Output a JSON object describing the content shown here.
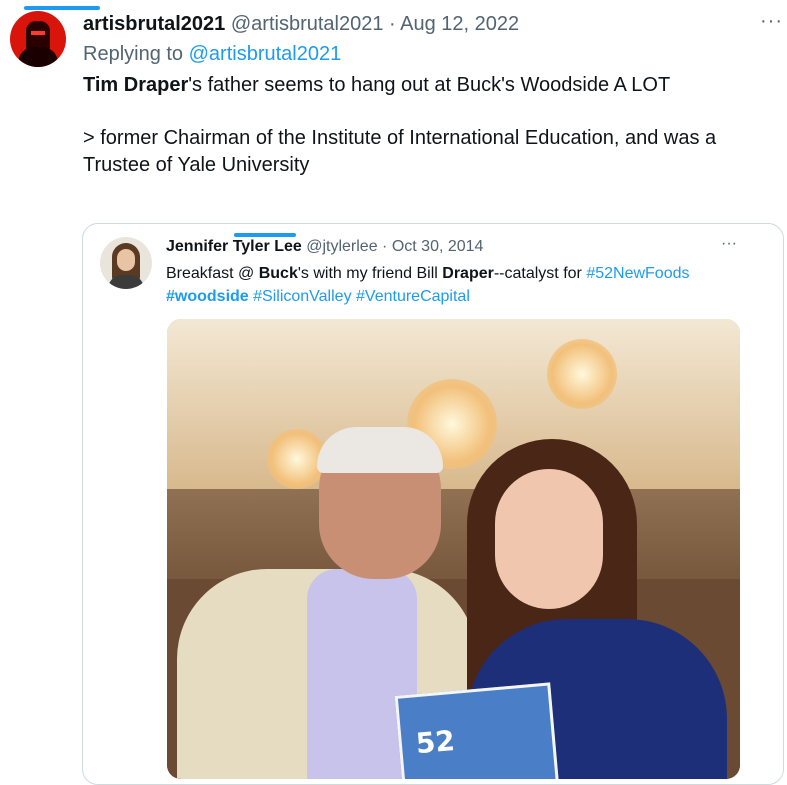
{
  "tweet": {
    "display_name": "artisbrutal2021",
    "handle": "@artisbrutal2021",
    "separator": "·",
    "date": "Aug 12, 2022",
    "more": "···",
    "replying_prefix": "Replying to ",
    "replying_to": "@artisbrutal2021",
    "text_bold": "Tim Draper",
    "text_rest": "'s father seems to hang out at Buck's Woodside A LOT",
    "text_quote": "> former Chairman of the Institute of International Education, and was a Trustee of Yale University"
  },
  "quoted": {
    "display_name": "Jennifer Tyler Lee",
    "handle": "@jtylerlee",
    "separator": "·",
    "date": "Oct 30, 2014",
    "more": "···",
    "t1": "Breakfast @ ",
    "t2_bold": "Buck",
    "t3": "'s with my friend Bill ",
    "t4_bold": "Draper",
    "t5": "--catalyst for ",
    "hashtag1": "#52NewFoods",
    "hashtag2": "#woodside",
    "hashtag3": "#SiliconValley",
    "hashtag4": "#VentureCapital",
    "photo_book_text": "52"
  },
  "colors": {
    "link": "#1d9bf0",
    "muted": "#536471",
    "text": "#0f1419"
  }
}
